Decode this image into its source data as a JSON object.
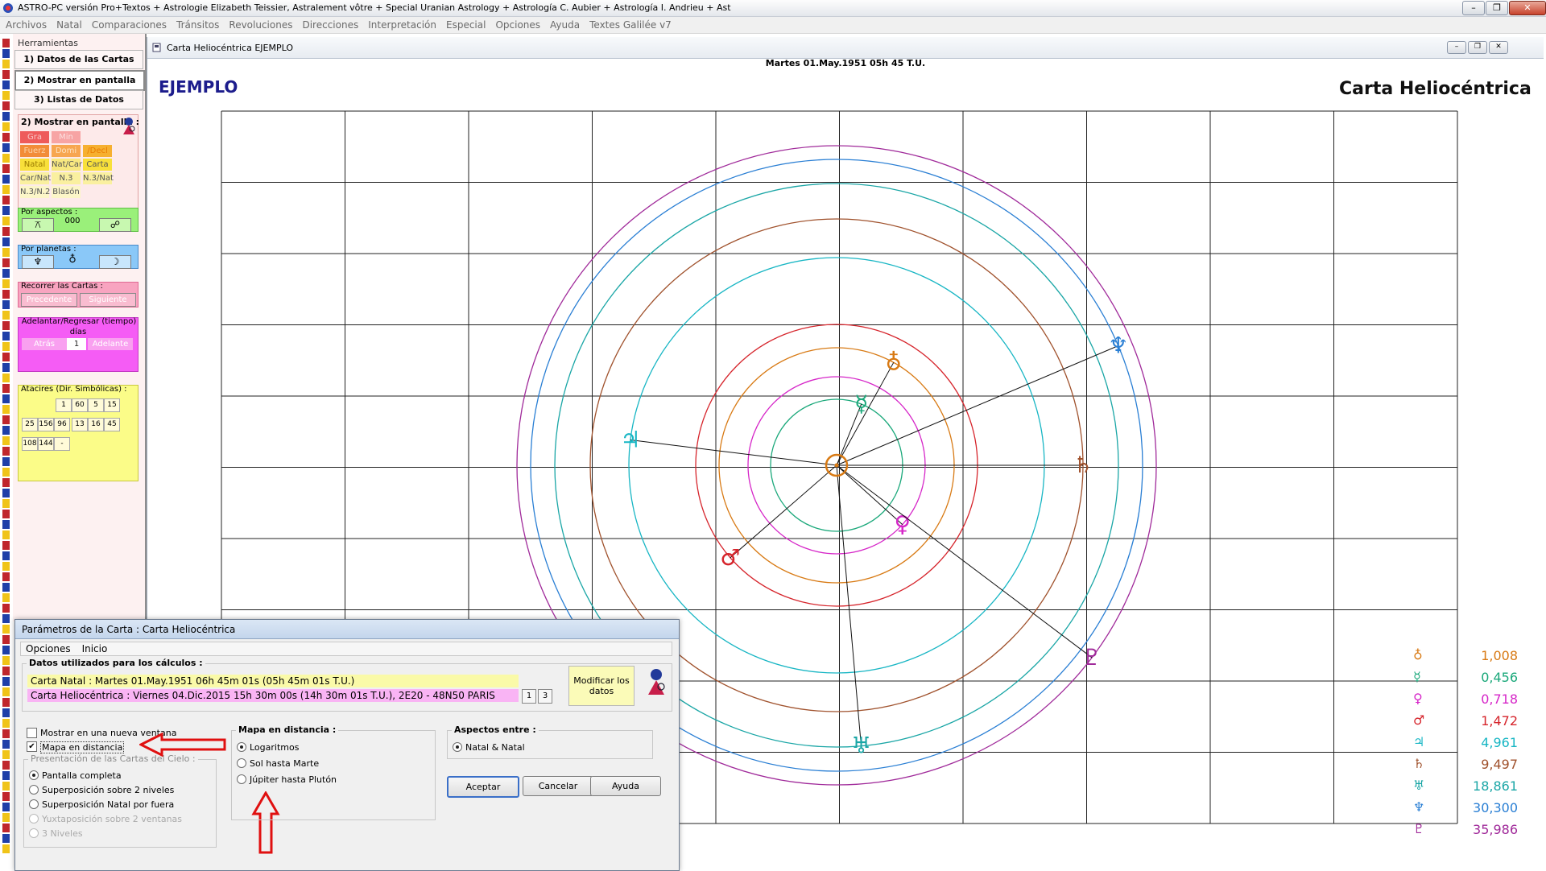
{
  "window": {
    "title": "ASTRO-PC versión Pro+Textos + Astrologie Elizabeth Teissier, Astralement vôtre + Special Uranian Astrology + Astrología C. Aubier + Astrología I. Andrieu + Ast",
    "minimize": "–",
    "restore": "❐",
    "close": "✕"
  },
  "menu": [
    "Archivos",
    "Natal",
    "Comparaciones",
    "Tránsitos",
    "Revoluciones",
    "Direcciones",
    "Interpretación",
    "Especial",
    "Opciones",
    "Ayuda",
    "Textes Galilée v7"
  ],
  "colors": {
    "strip": [
      "#c0262c",
      "#1f3fa8",
      "#f0c419",
      "#c0262c",
      "#1f3fa8",
      "#f0c419"
    ],
    "leftpanel_bg": "#fdf1f1",
    "chart_title": "#1c1c8c"
  },
  "left": {
    "heading": "Herramientas",
    "tabs": [
      "1) Datos de las Cartas",
      "2) Mostrar en pantalla",
      "3) Listas de Datos"
    ],
    "mostrar_title": "2) Mostrar en pantalla :",
    "grid_buttons": [
      [
        "Gra",
        "Min"
      ],
      [
        "Fuerz",
        "Domi",
        "/Decl"
      ],
      [
        "Natal",
        "Nat/Car",
        "Carta"
      ],
      [
        "Car/Nat",
        "N.3",
        "N.3/Nat"
      ],
      [
        "N.3/N.2",
        "Blasón"
      ]
    ],
    "por_aspectos": "Por aspectos :",
    "aspect_buttons": [
      "⚻",
      "000",
      "☍"
    ],
    "por_planetas": "Por planetas :",
    "planet_buttons": [
      "♆",
      "♁",
      "☽"
    ],
    "recorrer": "Recorrer las Cartas :",
    "prev": "Precedente",
    "next": "Siguiente",
    "adelantar": "Adelantar/Regresar (tiempo)",
    "dias": "días",
    "atras": "Atrás",
    "days_value": "1",
    "adelante": "Adelante",
    "atacires": "Atacires (Dir. Simbólicas) :",
    "atacires_row1": [
      "1",
      "60",
      "5",
      "15"
    ],
    "atacires_row2": [
      "25",
      "156",
      "96",
      "13",
      "16",
      "45"
    ],
    "atacires_row3": [
      "108",
      "144",
      "-"
    ]
  },
  "chart_window": {
    "title": "Carta Heliocéntrica  EJEMPLO",
    "date_line": "Martes 01.May.1951 05h 45 T.U.",
    "chart_name": "EJEMPLO",
    "chart_type": "Carta Heliocéntrica"
  },
  "planets": [
    {
      "name": "Sun",
      "glyph": "☉",
      "color": "#d87a14"
    },
    {
      "name": "Earth",
      "glyph": "♁",
      "color": "#d87a14"
    },
    {
      "name": "Mercury",
      "glyph": "☿",
      "color": "#1aa87a"
    },
    {
      "name": "Venus",
      "glyph": "♀",
      "color": "#d626c8"
    },
    {
      "name": "Mars",
      "glyph": "♂",
      "color": "#d6252c"
    },
    {
      "name": "Jupiter",
      "glyph": "♃",
      "color": "#18b6c4"
    },
    {
      "name": "Saturn",
      "glyph": "♄",
      "color": "#a0522d"
    },
    {
      "name": "Uranus",
      "glyph": "♅",
      "color": "#1aa6a6"
    },
    {
      "name": "Neptune",
      "glyph": "♆",
      "color": "#2a7fd4"
    },
    {
      "name": "Pluto",
      "glyph": "♇",
      "color": "#a02a9a"
    }
  ],
  "distances": [
    {
      "glyph": "♁",
      "value": "1,008",
      "color": "#d87a14"
    },
    {
      "glyph": "☿",
      "value": "0,456",
      "color": "#1aa87a"
    },
    {
      "glyph": "♀",
      "value": "0,718",
      "color": "#d626c8"
    },
    {
      "glyph": "♂",
      "value": "1,472",
      "color": "#d6252c"
    },
    {
      "glyph": "♃",
      "value": "4,961",
      "color": "#18b6c4"
    },
    {
      "glyph": "♄",
      "value": "9,497",
      "color": "#a0522d"
    },
    {
      "glyph": "♅",
      "value": "18,861",
      "color": "#1aa6a6"
    },
    {
      "glyph": "♆",
      "value": "30,300",
      "color": "#2a7fd4"
    },
    {
      "glyph": "♇",
      "value": "35,986",
      "color": "#a02a9a"
    }
  ],
  "dialog": {
    "title": "Parámetros de la Carta : Carta Heliocéntrica",
    "menu": [
      "Opciones",
      "Inicio"
    ],
    "datos_legend": "Datos utilizados para los cálculos :",
    "natal_line": "Carta Natal : Martes 01.May.1951 06h 45m 01s (05h 45m 01s T.U.)",
    "helio_line": "Carta Heliocéntrica : Viernes 04.Dic.2015 15h 30m 00s (14h 30m 01s T.U.), 2E20 - 48N50  PARIS",
    "btn1": "1",
    "btn3": "3",
    "modificar": "Modificar los datos",
    "chk_nueva": "Mostrar en una nueva ventana",
    "chk_mapa": "Mapa en distancia",
    "presentacion_legend": "Presentación de las Cartas del Cielo :",
    "presentacion": [
      "Pantalla completa",
      "Superposición sobre 2 niveles",
      "Superposición Natal por fuera",
      "Yuxtaposición sobre 2 ventanas",
      "3 Niveles"
    ],
    "mapa_legend": "Mapa en distancia :",
    "mapa_opts": [
      "Logaritmos",
      "Sol hasta Marte",
      "Júpiter hasta Plutón"
    ],
    "aspectos_legend": "Aspectos entre :",
    "aspectos_opt": "Natal & Natal",
    "aceptar": "Aceptar",
    "cancelar": "Cancelar",
    "ayuda": "Ayuda"
  }
}
